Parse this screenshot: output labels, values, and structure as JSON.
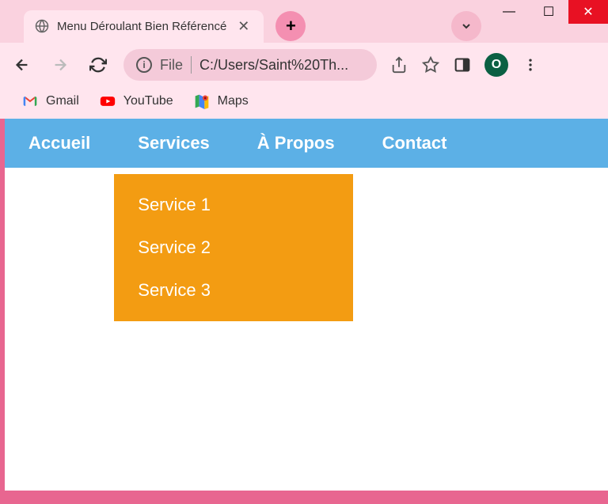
{
  "window": {
    "minimize": "—",
    "maximize": "☐",
    "close": "✕"
  },
  "tab": {
    "title": "Menu Déroulant Bien Référencé"
  },
  "address": {
    "scheme": "File",
    "path": "C:/Users/Saint%20Th..."
  },
  "profile": {
    "letter": "O"
  },
  "bookmarks": [
    {
      "label": "Gmail"
    },
    {
      "label": "YouTube"
    },
    {
      "label": "Maps"
    }
  ],
  "nav": {
    "items": [
      {
        "label": "Accueil"
      },
      {
        "label": "Services"
      },
      {
        "label": "À Propos"
      },
      {
        "label": "Contact"
      }
    ],
    "dropdown": [
      {
        "label": "Service 1"
      },
      {
        "label": "Service 2"
      },
      {
        "label": "Service 3"
      }
    ]
  }
}
